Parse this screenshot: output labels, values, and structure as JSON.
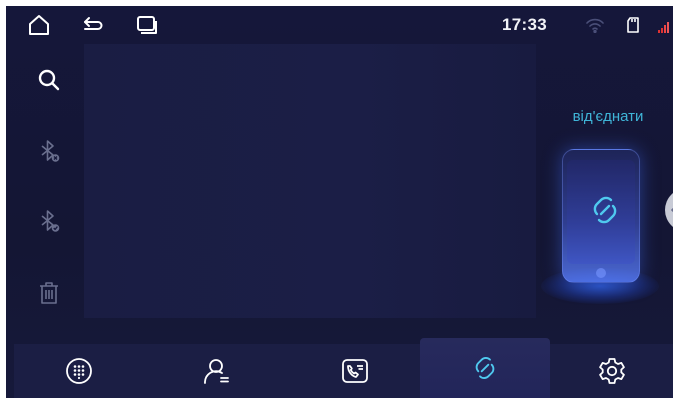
{
  "status_bar": {
    "time": "17:33",
    "icons": [
      "home-icon",
      "back-icon",
      "recent-apps-icon",
      "wifi-icon",
      "sd-card-icon",
      "signal-icon"
    ]
  },
  "sidebar": {
    "items": [
      {
        "name": "search-icon"
      },
      {
        "name": "bluetooth-remove-icon"
      },
      {
        "name": "bluetooth-connected-icon"
      },
      {
        "name": "trash-icon"
      }
    ]
  },
  "main": {
    "disconnect_label": "від'єднати"
  },
  "bottom_nav": {
    "tabs": [
      {
        "name": "dialpad-icon",
        "active": false
      },
      {
        "name": "contacts-icon",
        "active": false
      },
      {
        "name": "call-log-icon",
        "active": false
      },
      {
        "name": "link-icon",
        "active": true
      },
      {
        "name": "settings-icon",
        "active": false
      }
    ]
  },
  "colors": {
    "background": "#15173a",
    "accent": "#3fb5d8",
    "panel": "#1b1e44",
    "icon": "#ffffff",
    "icon_dim": "#6a6f8e"
  }
}
